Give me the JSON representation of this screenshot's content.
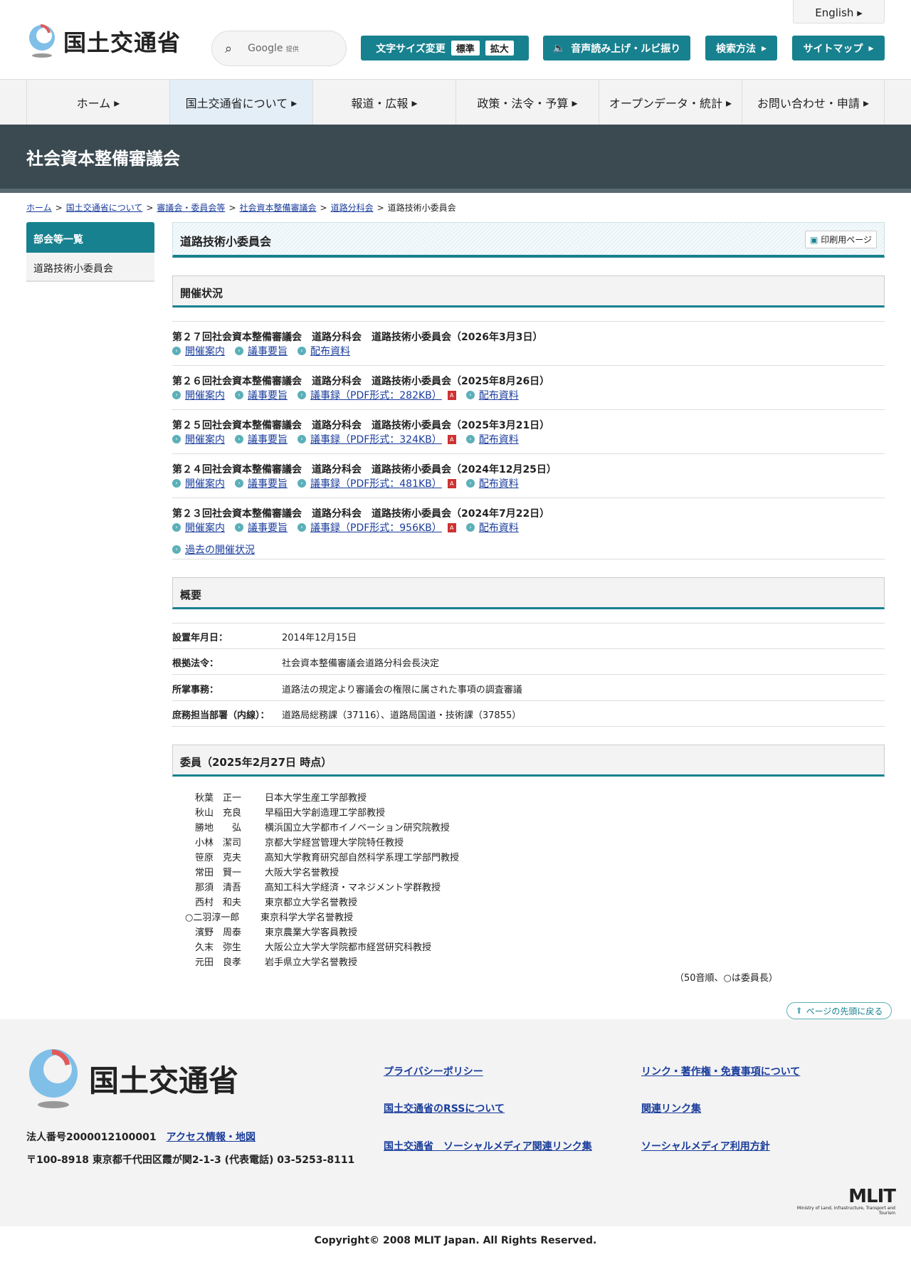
{
  "header": {
    "english": "English",
    "logo_text": "国土交通省",
    "search_label": "Google",
    "search_sub": "提供",
    "text_size_label": "文字サイズ変更",
    "size_standard": "標準",
    "size_large": "拡大",
    "voice": "音声読み上げ・ルビ振り",
    "search_method": "検索方法",
    "sitemap": "サイトマップ"
  },
  "nav": [
    "ホーム",
    "国土交通省について",
    "報道・広報",
    "政策・法令・予算",
    "オープンデータ・統計",
    "お問い合わせ・申請"
  ],
  "banner_title": "社会資本整備審議会",
  "breadcrumb": [
    "ホーム",
    "国土交通省について",
    "審議会・委員会等",
    "社会資本整備審議会",
    "道路分科会",
    "道路技術小委員会"
  ],
  "sidebar": {
    "heading": "部会等一覧",
    "item": "道路技術小委員会"
  },
  "page_title": "道路技術小委員会",
  "print_label": "印刷用ページ",
  "meetings_heading": "開催状況",
  "meetings": [
    {
      "title": "第２７回社会資本整備審議会　道路分科会　道路技術小委員会（2026年3月3日）",
      "links": [
        "開催案内",
        "議事要旨",
        "配布資料"
      ],
      "minutes": null
    },
    {
      "title": "第２６回社会資本整備審議会　道路分科会　道路技術小委員会（2025年8月26日）",
      "links": [
        "開催案内",
        "議事要旨"
      ],
      "minutes": "議事録（PDF形式：282KB）",
      "last": "配布資料"
    },
    {
      "title": "第２５回社会資本整備審議会　道路分科会　道路技術小委員会（2025年3月21日）",
      "links": [
        "開催案内",
        "議事要旨"
      ],
      "minutes": "議事録（PDF形式：324KB）",
      "last": "配布資料"
    },
    {
      "title": "第２４回社会資本整備審議会　道路分科会　道路技術小委員会（2024年12月25日）",
      "links": [
        "開催案内",
        "議事要旨"
      ],
      "minutes": "議事録（PDF形式：481KB）",
      "last": "配布資料"
    },
    {
      "title": "第２３回社会資本整備審議会　道路分科会　道路技術小委員会（2024年7月22日）",
      "links": [
        "開催案内",
        "議事要旨"
      ],
      "minutes": "議事録（PDF形式：956KB）",
      "last": "配布資料"
    }
  ],
  "past_link": "過去の開催状況",
  "overview_heading": "概要",
  "overview": [
    {
      "k": "設置年月日：",
      "v": "2014年12月15日"
    },
    {
      "k": "根拠法令：",
      "v": "社会資本整備審議会道路分科会長決定"
    },
    {
      "k": "所掌事務：",
      "v": "道路法の規定より審議会の権限に属された事項の調査審議"
    },
    {
      "k": "庶務担当部署（内線）：",
      "v": "道路局総務課（37116）、道路局国道・技術課（37855）"
    }
  ],
  "members_heading": "委員（2025年2月27日 時点）",
  "members": [
    {
      "n": "秋葉　正一",
      "a": "日本大学生産工学部教授"
    },
    {
      "n": "秋山　充良",
      "a": "早稲田大学創造理工学部教授"
    },
    {
      "n": "勝地　　弘",
      "a": "横浜国立大学都市イノベーション研究院教授"
    },
    {
      "n": "小林　潔司",
      "a": "京都大学経営管理大学院特任教授"
    },
    {
      "n": "笹原　克夫",
      "a": "高知大学教育研究部自然科学系理工学部門教授"
    },
    {
      "n": "常田　賢一",
      "a": "大阪大学名誉教授"
    },
    {
      "n": "那須　清吾",
      "a": "高知工科大学経済・マネジメント学群教授"
    },
    {
      "n": "西村　和夫",
      "a": "東京都立大学名誉教授"
    },
    {
      "n": "○二羽淳一郎",
      "a": "東京科学大学名誉教授"
    },
    {
      "n": "濱野　周泰",
      "a": "東京農業大学客員教授"
    },
    {
      "n": "久末　弥生",
      "a": "大阪公立大学大学院都市経営研究科教授"
    },
    {
      "n": "元田　良孝",
      "a": "岩手県立大学名誉教授"
    }
  ],
  "members_note": "（50音順、○は委員長）",
  "page_top": "ページの先頭に戻る",
  "footer": {
    "logo_text": "国土交通省",
    "corp_no": "法人番号2000012100001",
    "access": "アクセス情報・地図",
    "address": "〒100-8918 東京都千代田区霞が関2-1-3 (代表電話) 03-5253-8111",
    "links": [
      "プライバシーポリシー",
      "リンク・著作権・免責事項について",
      "国土交通省のRSSについて",
      "関連リンク集",
      "国土交通省　ソーシャルメディア関連リンク集",
      "ソーシャルメディア利用方針"
    ],
    "mlit": "MLIT",
    "mlit_sub": "Ministry of Land, Infrastructure, Transport and Tourism",
    "copyright": "Copyright© 2008 MLIT Japan. All Rights Reserved."
  },
  "colors": {
    "accent": "#17818f",
    "banner": "#3b4a51",
    "link": "#1a3d9c"
  }
}
